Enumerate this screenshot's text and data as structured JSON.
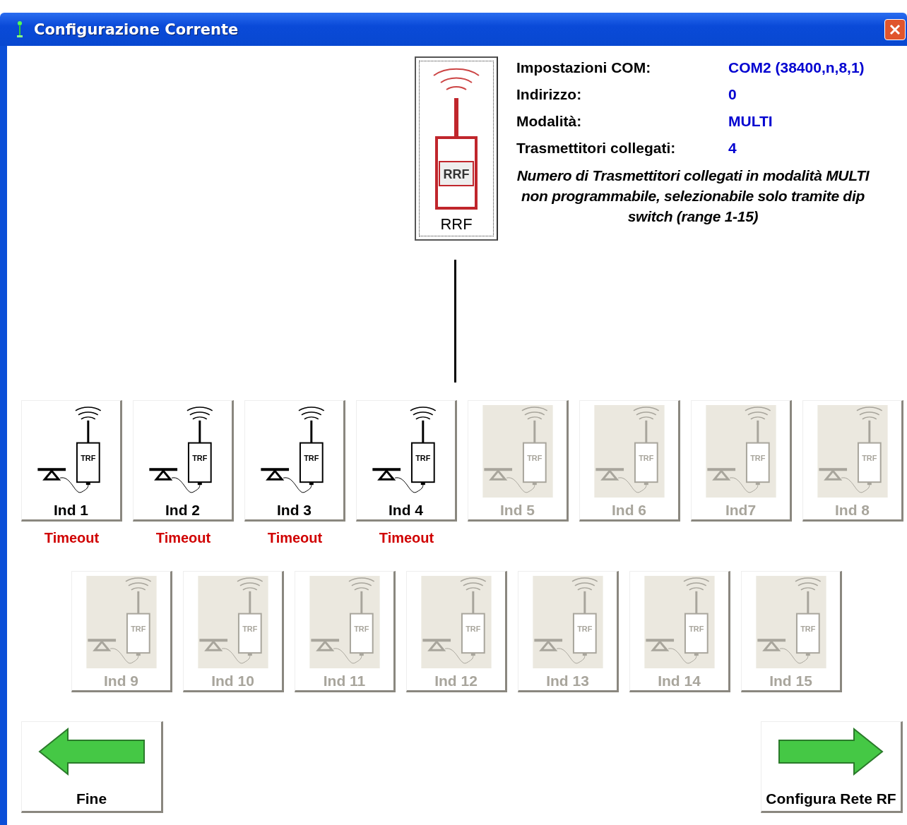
{
  "window": {
    "title": "Configurazione Corrente"
  },
  "receiver": {
    "device_label": "RRF",
    "label": "RRF"
  },
  "settings": [
    {
      "label": "Impostazioni COM:",
      "value": "COM2  (38400,n,8,1)"
    },
    {
      "label": "Indirizzo:",
      "value": "0"
    },
    {
      "label": "Modalità:",
      "value": "MULTI"
    },
    {
      "label": "Trasmettitori collegati:",
      "value": "4"
    }
  ],
  "note": "Numero di Trasmettitori collegati in modalità MULTI non programmabile, selezionabile solo tramite dip switch (range 1-15)",
  "indicator_rows": [
    [
      {
        "label": "Ind 1",
        "device_label": "TRF",
        "enabled": true,
        "status": "Timeout"
      },
      {
        "label": "Ind 2",
        "device_label": "TRF",
        "enabled": true,
        "status": "Timeout"
      },
      {
        "label": "Ind 3",
        "device_label": "TRF",
        "enabled": true,
        "status": "Timeout"
      },
      {
        "label": "Ind 4",
        "device_label": "TRF",
        "enabled": true,
        "status": "Timeout"
      },
      {
        "label": "Ind 5",
        "device_label": "TRF",
        "enabled": false
      },
      {
        "label": "Ind 6",
        "device_label": "TRF",
        "enabled": false
      },
      {
        "label": "Ind7",
        "device_label": "TRF",
        "enabled": false
      },
      {
        "label": "Ind 8",
        "device_label": "TRF",
        "enabled": false
      }
    ],
    [
      {
        "label": "Ind 9",
        "device_label": "TRF",
        "enabled": false
      },
      {
        "label": "Ind 10",
        "device_label": "TRF",
        "enabled": false
      },
      {
        "label": "Ind 11",
        "device_label": "TRF",
        "enabled": false
      },
      {
        "label": "Ind 12",
        "device_label": "TRF",
        "enabled": false
      },
      {
        "label": "Ind 13",
        "device_label": "TRF",
        "enabled": false
      },
      {
        "label": "Ind 14",
        "device_label": "TRF",
        "enabled": false
      },
      {
        "label": "Ind 15",
        "device_label": "TRF",
        "enabled": false
      }
    ]
  ],
  "buttons": [
    {
      "kind": "back",
      "label": "Fine"
    },
    {
      "kind": "forward",
      "label": "Configura Rete RF"
    }
  ]
}
